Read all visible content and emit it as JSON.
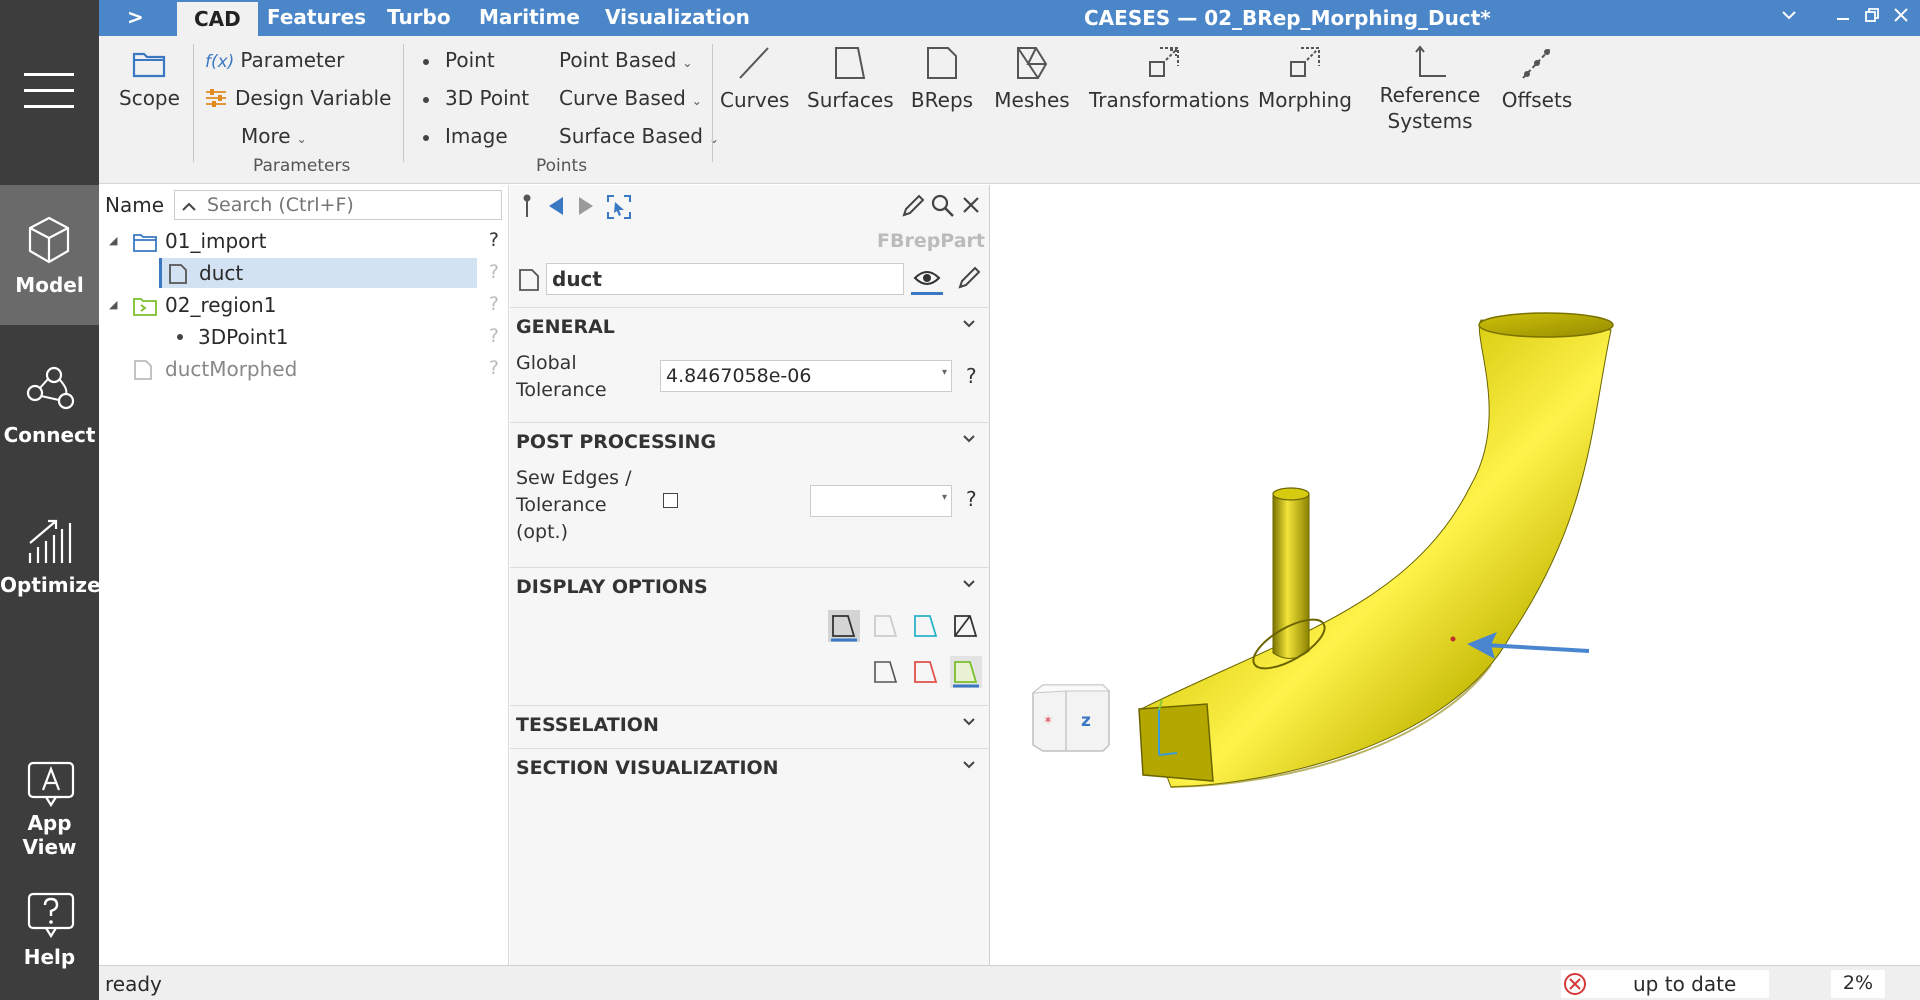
{
  "sidebar": {
    "items": [
      {
        "label": "Model",
        "icon": "cube-icon"
      },
      {
        "label": "Connect",
        "icon": "connect-icon"
      },
      {
        "label": "Optimize",
        "icon": "optimize-icon"
      },
      {
        "label": "App View",
        "icon": "app-view-icon"
      },
      {
        "label": "Help",
        "icon": "help-icon"
      }
    ]
  },
  "titlebar": {
    "expand": ">",
    "tabs": [
      "CAD",
      "Features",
      "Turbo",
      "Maritime",
      "Visualization"
    ],
    "title": "CAESES — 02_BRep_Morphing_Duct*"
  },
  "ribbon": {
    "scope": "Scope",
    "parameter": "Parameter",
    "parameter_prefix": "f(x)",
    "design_variable": "Design Variable",
    "more": "More",
    "parameters_group": "Parameters",
    "point": "Point",
    "point_3d": "3D Point",
    "image": "Image",
    "point_based": "Point Based",
    "curve_based": "Curve Based",
    "surface_based": "Surface Based",
    "points_group": "Points",
    "curves": "Curves",
    "surfaces": "Surfaces",
    "breps": "BReps",
    "meshes": "Meshes",
    "transformations": "Transformations",
    "morphing": "Morphing",
    "reference_line1": "Reference",
    "reference_line2": "Systems",
    "offsets": "Offsets"
  },
  "tree": {
    "name_header": "Name",
    "search_placeholder": "Search (Ctrl+F)",
    "rows": [
      {
        "label": "01_import",
        "q": "?"
      },
      {
        "label": "duct",
        "q": "?"
      },
      {
        "label": "02_region1",
        "q": "?"
      },
      {
        "label": "3DPoint1",
        "q": "?"
      },
      {
        "label": "ductMorphed",
        "q": "?"
      }
    ]
  },
  "props": {
    "type": "FBrepPart",
    "object_name": "duct",
    "general": "GENERAL",
    "global_tol_1": "Global",
    "global_tol_2": "Tolerance",
    "global_tol_value": "4.8467058e-06",
    "q": "?",
    "post_processing": "POST PROCESSING",
    "sew_1": "Sew Edges /",
    "sew_2": "Tolerance",
    "sew_3": "(opt.)",
    "display_options": "DISPLAY OPTIONS",
    "tesselation": "TESSELATION",
    "section_vis": "SECTION VISUALIZATION"
  },
  "viewport": {
    "axis_label": "z"
  },
  "status": {
    "text": "ready",
    "update": "up to date",
    "percent": "2%"
  },
  "colors": {
    "accent": "#4a86c8",
    "sidebar": "#3d3d3d",
    "duct_yellow": "#d9cc12",
    "arrow_blue": "#4a86d0"
  }
}
